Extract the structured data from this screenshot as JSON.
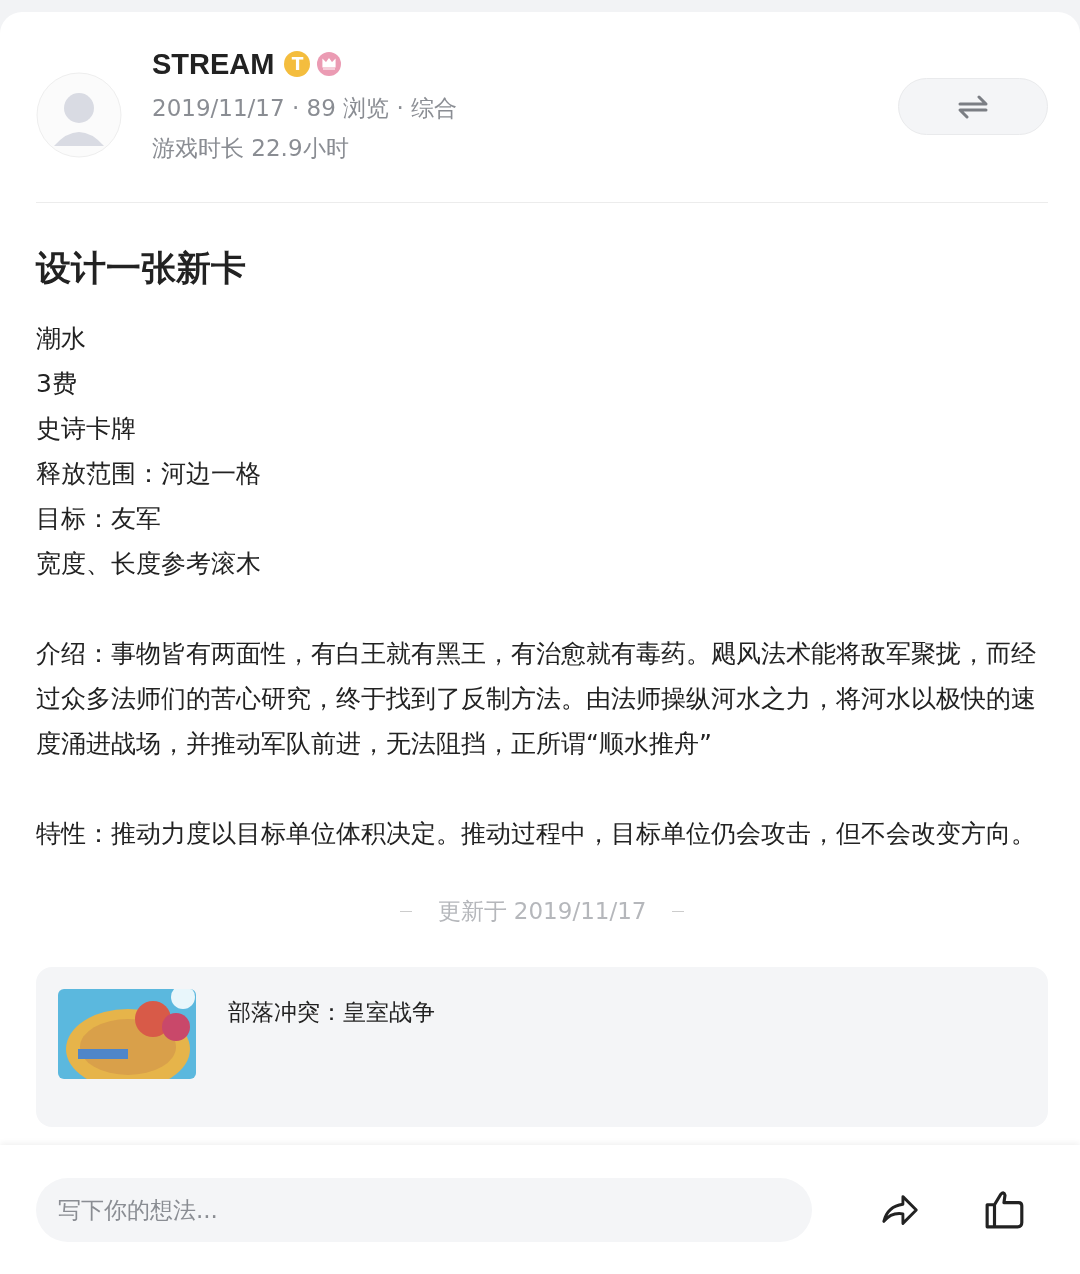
{
  "author": {
    "name": "STREAM",
    "badges": [
      {
        "kind": "level",
        "text": "T"
      },
      {
        "kind": "crown"
      }
    ],
    "meta": "2019/11/17 · 89 浏览 · 综合",
    "playtime": "游戏时长 22.9小时"
  },
  "post": {
    "title": "设计一张新卡",
    "body": [
      {
        "kind": "line",
        "text": "潮水"
      },
      {
        "kind": "line",
        "text": "3费"
      },
      {
        "kind": "line",
        "text": "史诗卡牌"
      },
      {
        "kind": "line",
        "text": "释放范围：河边一格"
      },
      {
        "kind": "line",
        "text": "目标：友军"
      },
      {
        "kind": "line",
        "text": "宽度、长度参考滚木"
      },
      {
        "kind": "paragraph",
        "text": "介绍：事物皆有两面性，有白王就有黑王，有治愈就有毒药。飓风法术能将敌军聚拢，而经过众多法师们的苦心研究，终于找到了反制方法。由法师操纵河水之力，将河水以极快的速度涌进战场，并推动军队前进，无法阻挡，正所谓“顺水推舟”"
      },
      {
        "kind": "paragraph",
        "text": "特性：推动力度以目标单位体积决定。推动过程中，目标单位仍会攻击，但不会改变方向。"
      }
    ],
    "updated": "更新于 2019/11/17"
  },
  "game": {
    "name": "部落冲突：皇室战争"
  },
  "comment_bar": {
    "placeholder": "写下你的想法..."
  }
}
